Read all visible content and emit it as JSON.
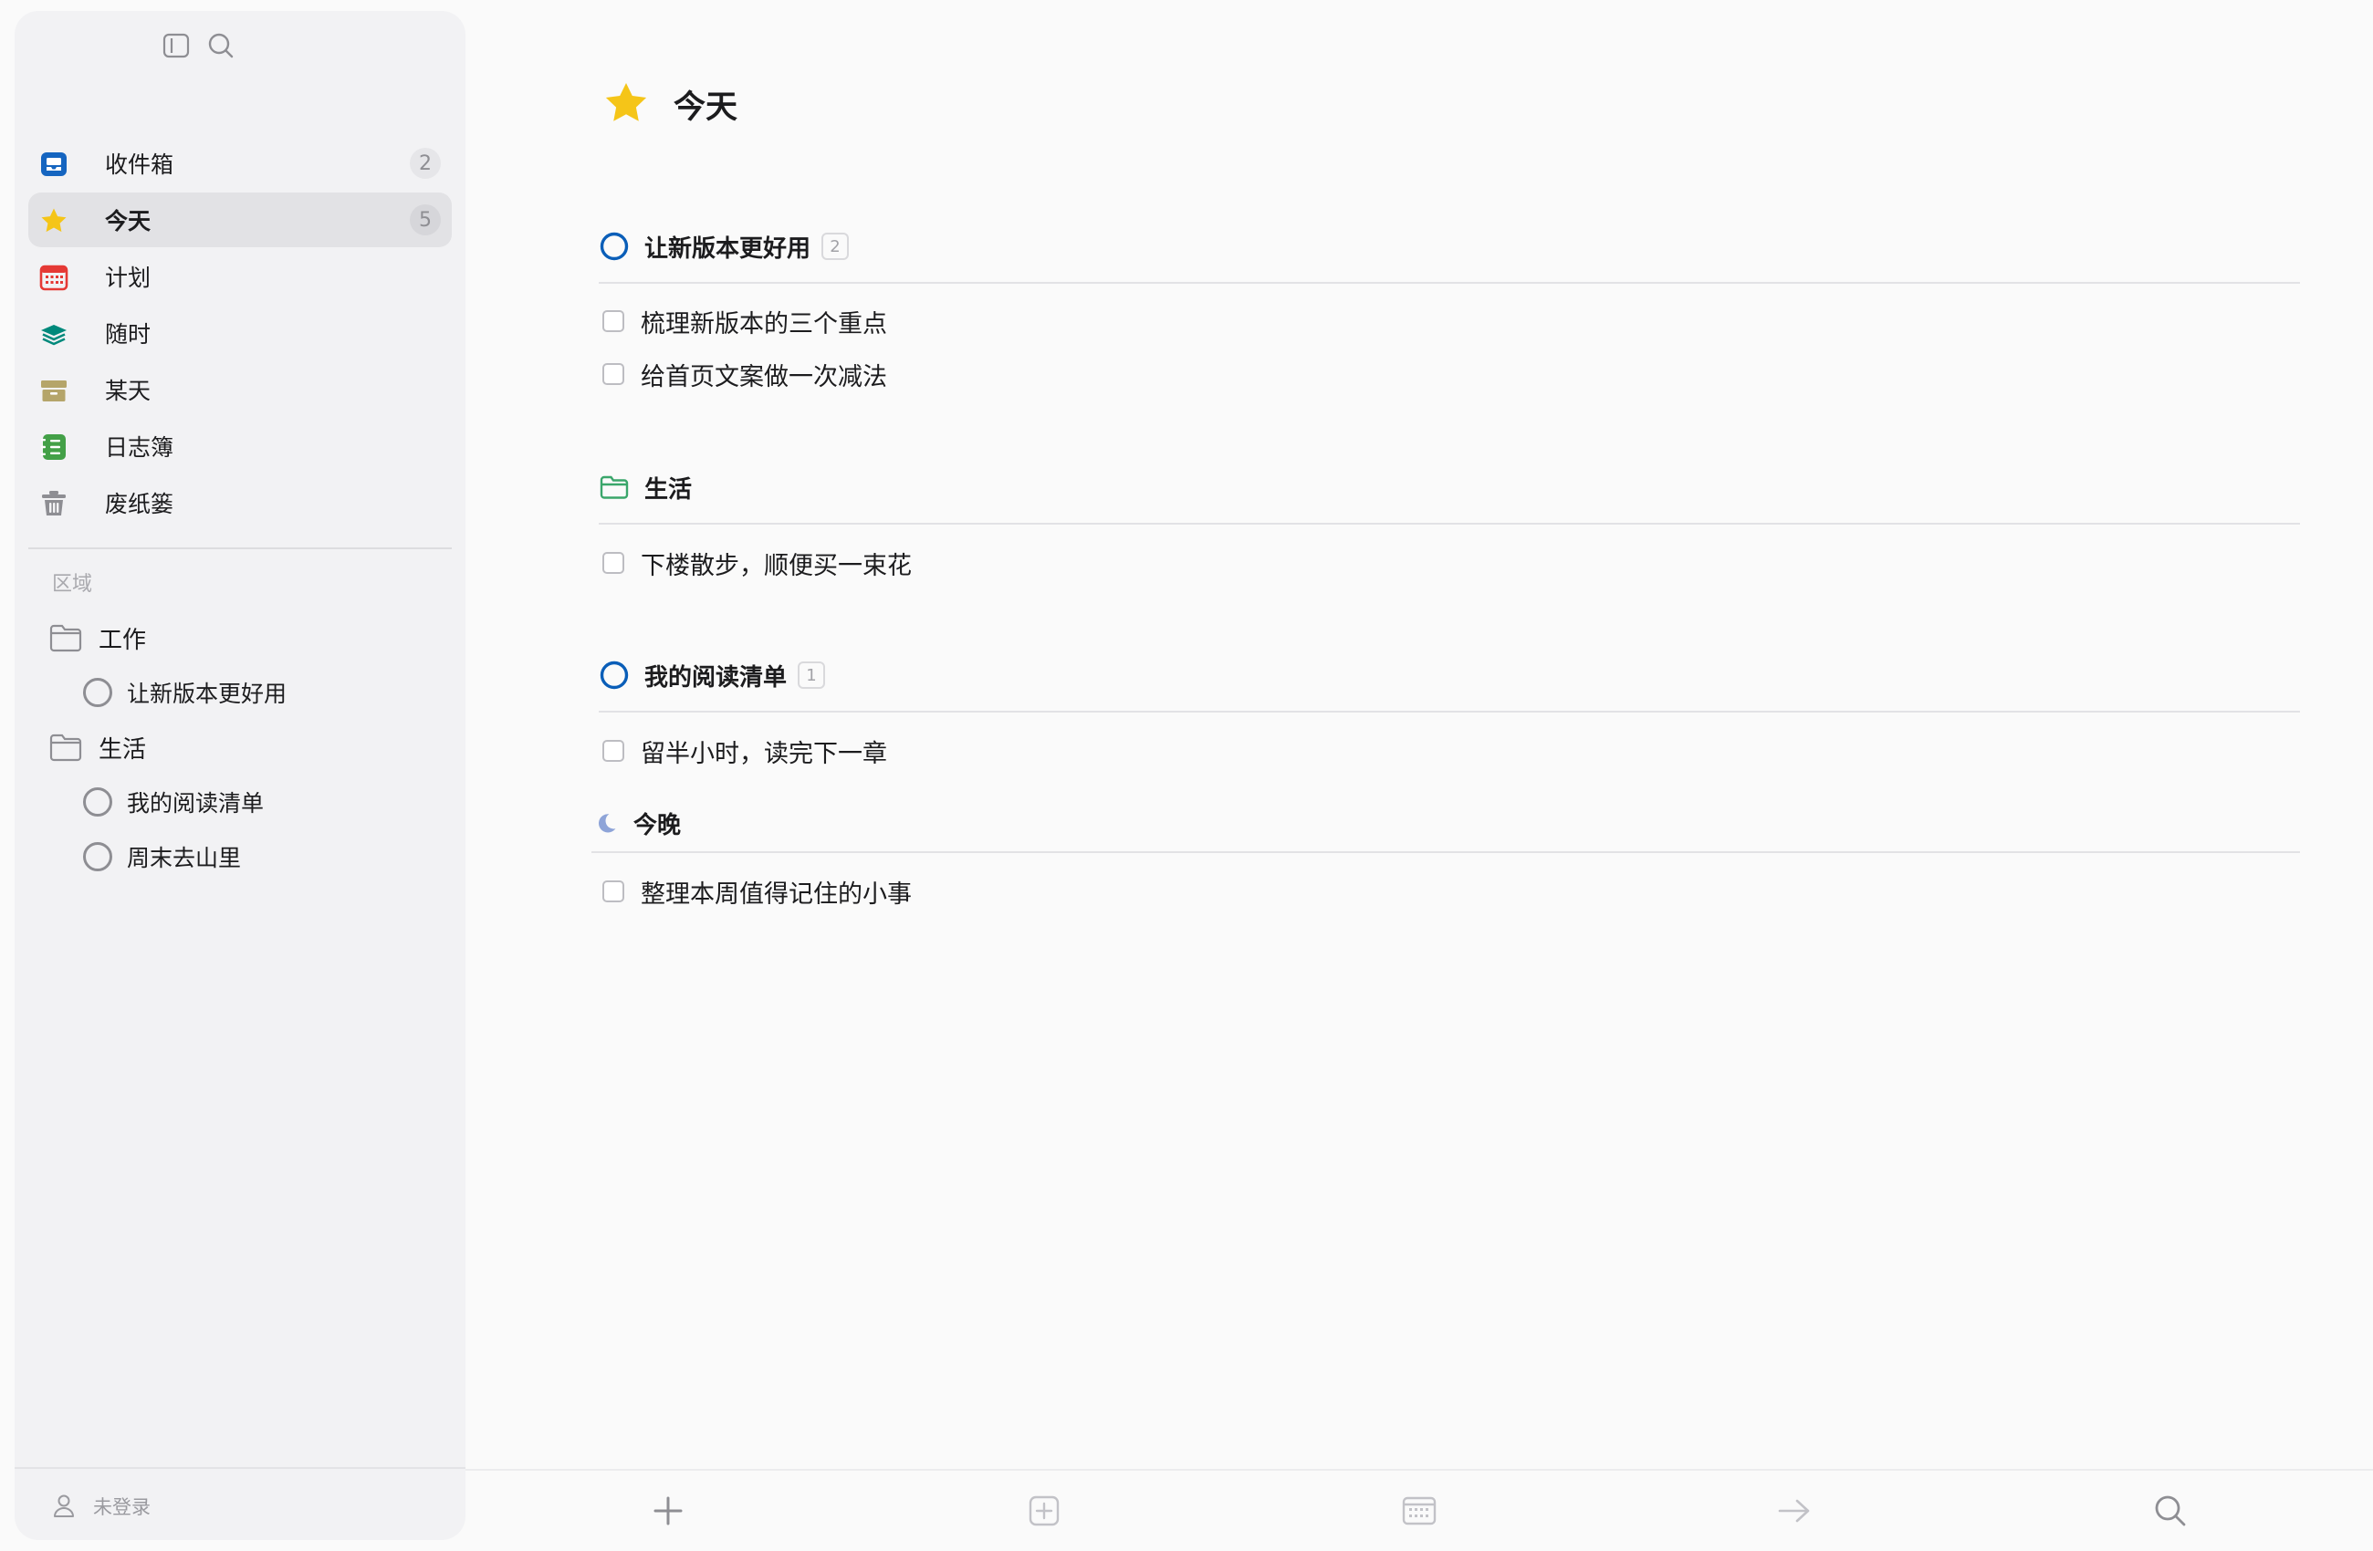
{
  "sidebar": {
    "nav": [
      {
        "label": "收件箱",
        "count": "2",
        "icon": "inbox-icon",
        "color": "#1565c0"
      },
      {
        "label": "今天",
        "count": "5",
        "icon": "star-icon",
        "color": "#f5c518"
      },
      {
        "label": "计划",
        "count": "",
        "icon": "calendar-icon",
        "color": "#e53935"
      },
      {
        "label": "随时",
        "count": "",
        "icon": "layers-icon",
        "color": "#00897b"
      },
      {
        "label": "某天",
        "count": "",
        "icon": "archive-box-icon",
        "color": "#b5a56a"
      },
      {
        "label": "日志簿",
        "count": "",
        "icon": "logbook-icon",
        "color": "#43a047"
      },
      {
        "label": "废纸篓",
        "count": "",
        "icon": "trash-icon",
        "color": "#8e8e93"
      }
    ],
    "areas_header": "区域",
    "tree": {
      "work": "工作",
      "work_project": "让新版本更好用",
      "life": "生活",
      "life_project_1": "我的阅读清单",
      "life_project_2": "周末去山里"
    },
    "footer_user": "未登录"
  },
  "main": {
    "title": "今天",
    "sections": {
      "s1": {
        "title": "让新版本更好用",
        "badge": "2",
        "tasks": [
          "梳理新版本的三个重点",
          "给首页文案做一次减法"
        ]
      },
      "s2": {
        "title": "生活",
        "tasks": [
          "下楼散步，顺便买一束花"
        ]
      },
      "s3": {
        "title": "我的阅读清单",
        "badge": "1",
        "tasks": [
          "留半小时，读完下一章"
        ]
      },
      "s4": {
        "title": "今晚",
        "tasks": [
          "整理本周值得记住的小事"
        ]
      }
    }
  },
  "colors": {
    "accent_blue": "#0a5eb8",
    "today_star": "#f5c518",
    "folder_green": "#3aa66b",
    "evening_moon": "#8ea4d8"
  }
}
